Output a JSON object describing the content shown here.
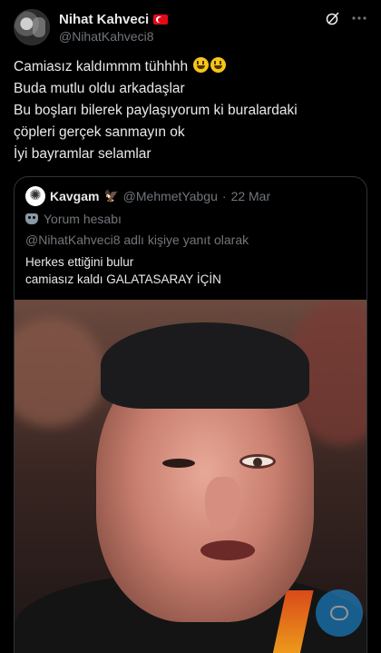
{
  "author": {
    "display_name": "Nihat Kahveci",
    "handle": "@NihatKahveci8",
    "flag_icon": "turkey-flag-icon"
  },
  "tweet": {
    "lines": [
      "Camiasız kaldımmm tühhhh",
      "Buda mutlu oldu  arkadaşlar",
      "Bu boşları bilerek paylaşıyorum ki buralardaki",
      "çöpleri gerçek sanmayın ok",
      "İyi bayramlar selamlar"
    ],
    "emojis": [
      "grinning-face-icon",
      "grinning-face-icon"
    ]
  },
  "quoted": {
    "display_name": "Kavgam",
    "badge_icon": "eagle-icon",
    "handle": "@MehmetYabgu",
    "separator": "·",
    "date": "22 Mar",
    "label": "Yorum hesabı",
    "reply_context": "@NihatKahveci8 adlı kişiye yanıt olarak",
    "text_line1": "Herkes ettiğini bulur",
    "text_line2": "camiasız kaldı GALATASARAY İÇİN"
  },
  "colors": {
    "background": "#000000",
    "text_primary": "#e7e9ea",
    "text_secondary": "#71767b",
    "border": "#2f3336",
    "accent": "#1d9bf0"
  }
}
